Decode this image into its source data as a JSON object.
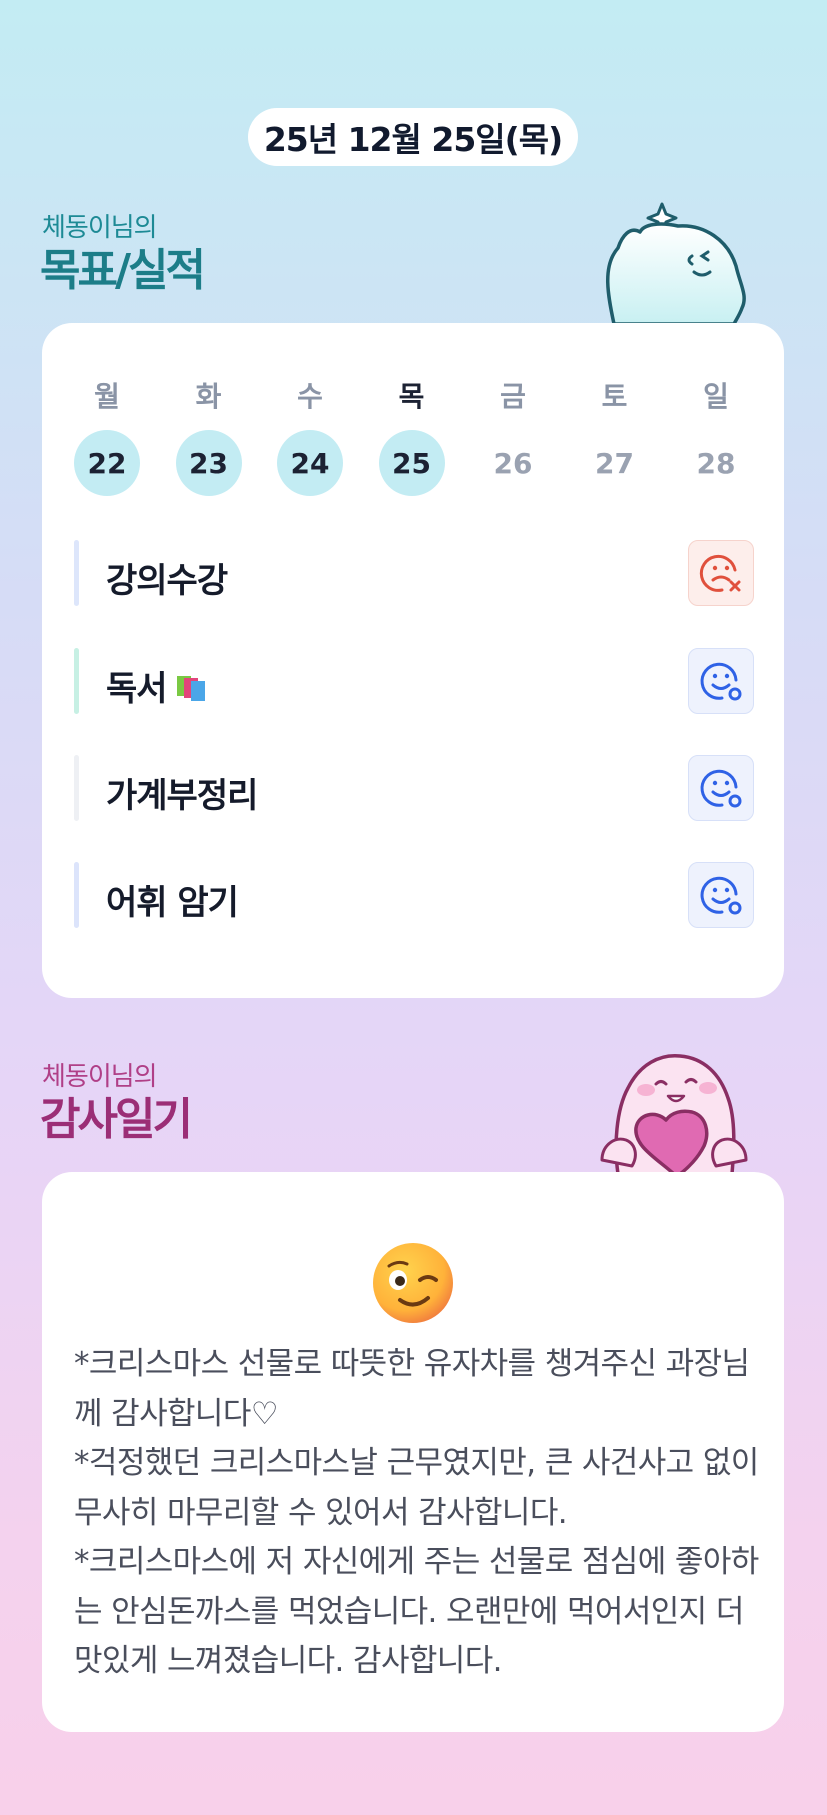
{
  "date_label": "25년 12월 25일(목)",
  "goals_section": {
    "subtitle": "체동이님의",
    "title": "목표/실적"
  },
  "week": {
    "days": [
      {
        "weekday": "월",
        "date": "22",
        "done": true,
        "today": false
      },
      {
        "weekday": "화",
        "date": "23",
        "done": true,
        "today": false
      },
      {
        "weekday": "수",
        "date": "24",
        "done": true,
        "today": false
      },
      {
        "weekday": "목",
        "date": "25",
        "done": true,
        "today": true
      },
      {
        "weekday": "금",
        "date": "26",
        "done": false,
        "today": false
      },
      {
        "weekday": "토",
        "date": "27",
        "done": false,
        "today": false
      },
      {
        "weekday": "일",
        "date": "28",
        "done": false,
        "today": false
      }
    ]
  },
  "tasks": [
    {
      "label": "강의수강",
      "bar_color": "#dde6fb",
      "status": "fail",
      "status_icon": "sad-face-x-icon"
    },
    {
      "label": "독서",
      "emoji": "books-icon",
      "bar_color": "#c7f0e4",
      "status": "success",
      "status_icon": "happy-face-o-icon"
    },
    {
      "label": "가계부정리",
      "bar_color": "#eef0f4",
      "status": "success",
      "status_icon": "happy-face-o-icon"
    },
    {
      "label": "어휘 암기",
      "bar_color": "#dce4fb",
      "status": "success",
      "status_icon": "happy-face-o-icon"
    }
  ],
  "diary_section": {
    "subtitle": "체동이님의",
    "title": "감사일기"
  },
  "diary": {
    "emoji": "winking-face-icon",
    "text": "*크리스마스 선물로 따뜻한 유자차를 챙겨주신 과장님께 감사합니다♡\n*걱정했던 크리스마스날 근무였지만, 큰 사건사고 없이 무사히 마무리할 수 있어서 감사합니다.\n*크리스마스에 저 자신에게 주는 선물로 점심에 좋아하는 안심돈까스를 먹었습니다. 오랜만에 먹어서인지 더 맛있게 느껴졌습니다. 감사합니다."
  },
  "colors": {
    "accent_teal": "#1c7d88",
    "accent_magenta": "#9b2e76",
    "done_circle": "#c3ecf3",
    "fail_red": "#e0503c",
    "ok_blue": "#2f62e6"
  }
}
